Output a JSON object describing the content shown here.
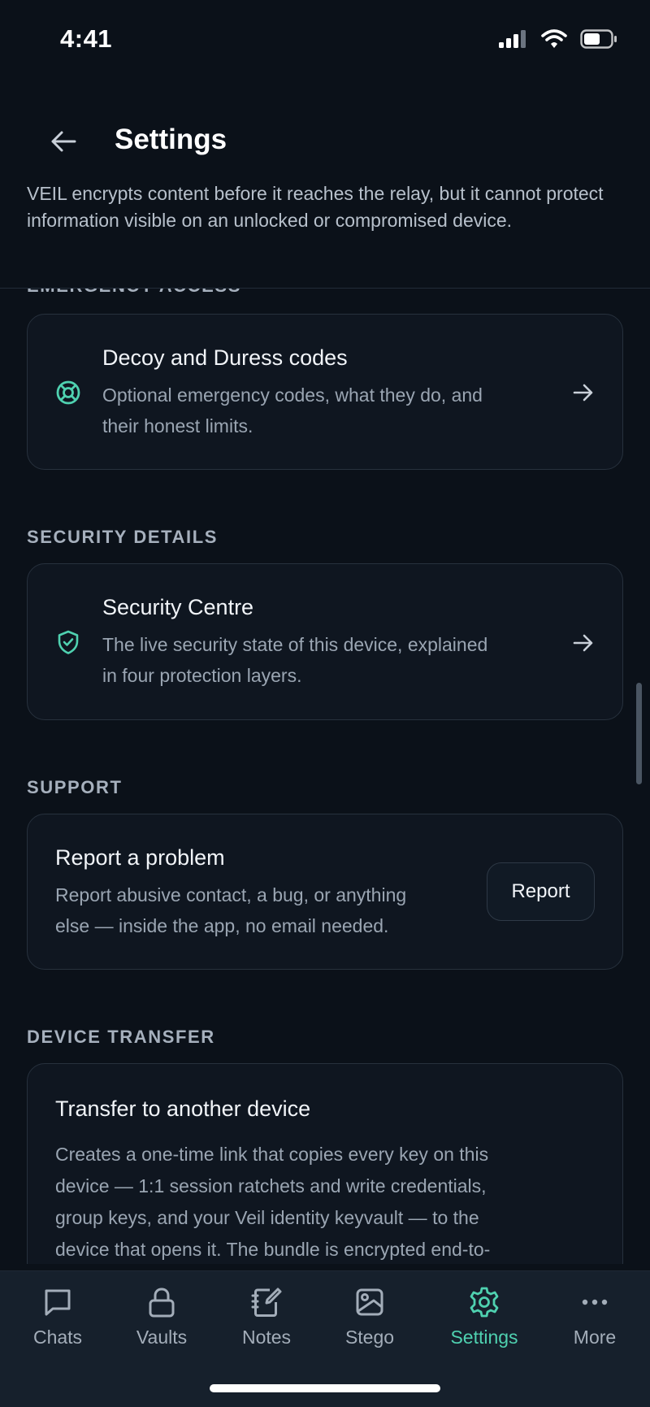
{
  "status_bar": {
    "time": "4:41"
  },
  "header": {
    "title": "Settings"
  },
  "intro": "VEIL encrypts content before it reaches the relay, but it cannot protect information visible on an unlocked or compromised device.",
  "sections": {
    "emergency": {
      "label": "EMERGENCY ACCESS",
      "item": {
        "title": "Decoy and Duress codes",
        "desc_line1": "Optional emergency codes, what they do, and",
        "desc_line2": "their honest limits.",
        "icon": "lifebuoy-icon"
      }
    },
    "security": {
      "label": "SECURITY DETAILS",
      "item": {
        "title": "Security Centre",
        "desc_line1": "The live security state of this device, explained",
        "desc_line2": "in four protection layers.",
        "icon": "shield-check-icon"
      }
    },
    "support": {
      "label": "SUPPORT",
      "item": {
        "title": "Report a problem",
        "desc_line1": "Report abusive contact, a bug, or anything",
        "desc_line2": "else — inside the app, no email needed.",
        "button_label": "Report"
      }
    },
    "transfer": {
      "label": "DEVICE TRANSFER",
      "item": {
        "title": "Transfer to another device",
        "desc_line1": "Creates a one-time link that copies every key on this",
        "desc_line2": "device — 1:1 session ratchets and write credentials,",
        "desc_line3": "group keys, and your Veil identity keyvault — to the",
        "desc_line4": "device that opens it. The bundle is encrypted end-to-"
      }
    }
  },
  "tabs": [
    {
      "label": "Chats",
      "icon": "chat-bubble-icon"
    },
    {
      "label": "Vaults",
      "icon": "lock-icon"
    },
    {
      "label": "Notes",
      "icon": "notebook-pen-icon"
    },
    {
      "label": "Stego",
      "icon": "image-icon"
    },
    {
      "label": "Settings",
      "icon": "gear-icon",
      "active": true
    },
    {
      "label": "More",
      "icon": "more-dots-icon"
    }
  ],
  "colors": {
    "accent": "#4fd1b0",
    "background": "#0b1119",
    "card": "#0f1620",
    "tab_bar": "#16202c"
  }
}
